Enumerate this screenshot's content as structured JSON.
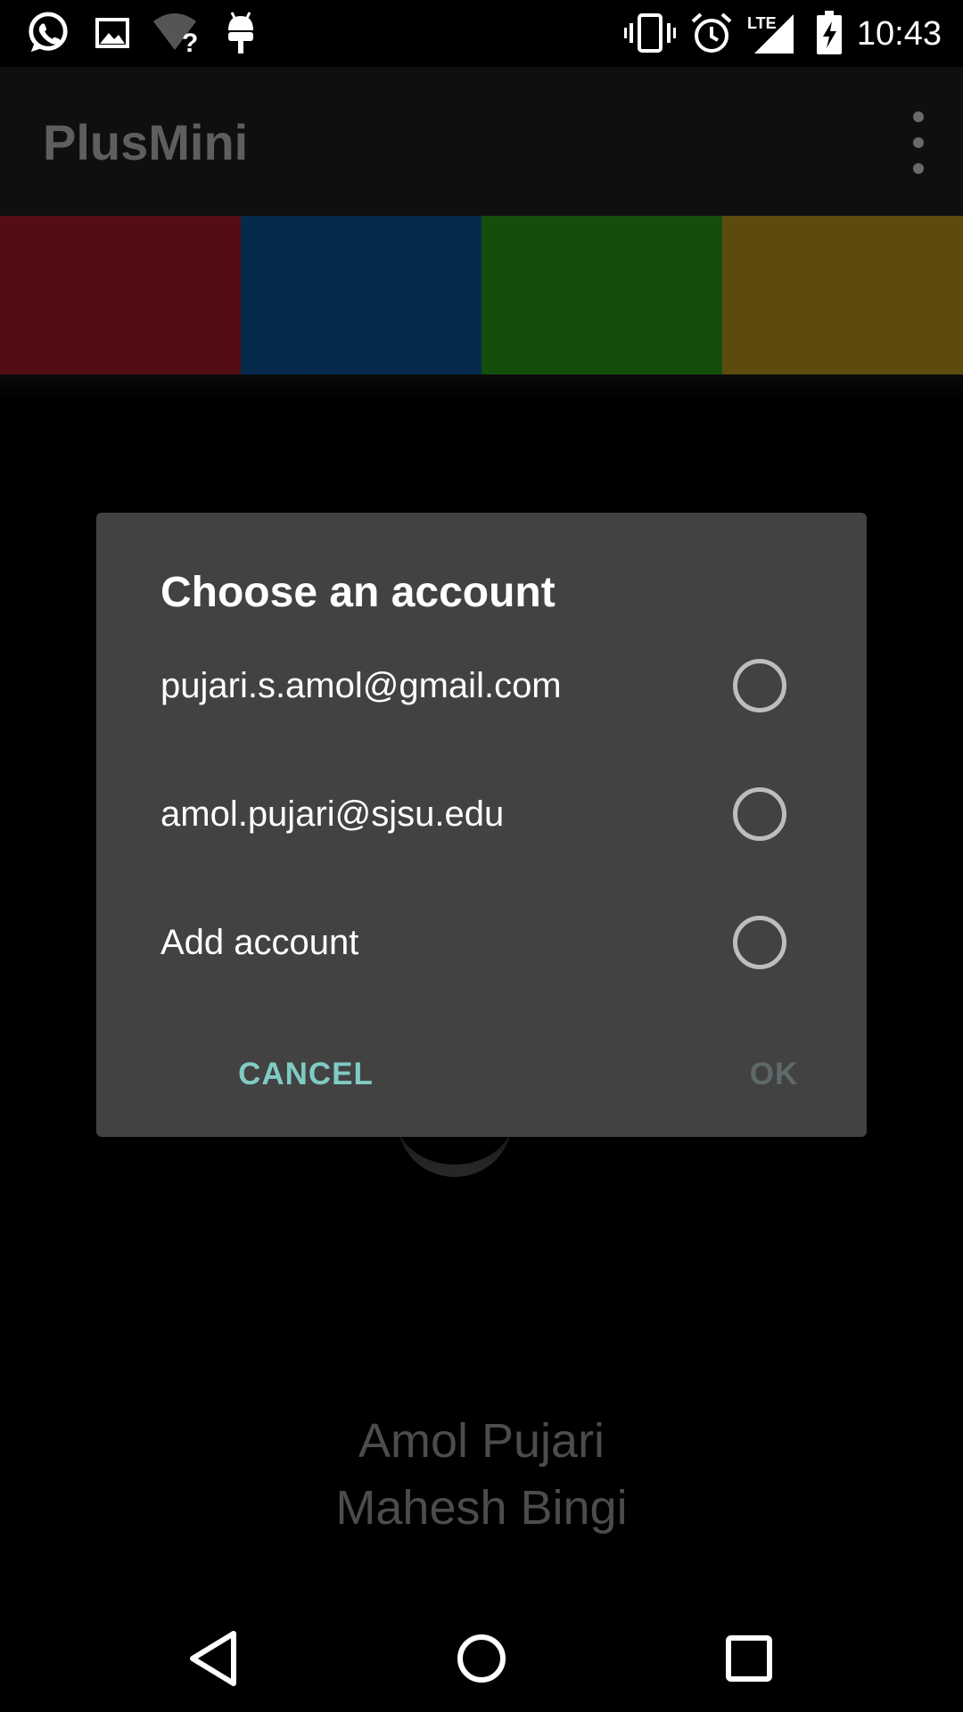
{
  "status_bar": {
    "time": "10:43",
    "left_icons": [
      "whatsapp-icon",
      "image-icon",
      "wifi-unknown-icon",
      "android-icon"
    ],
    "right_icons": [
      "vibrate-icon",
      "alarm-icon",
      "lte-signal-icon",
      "battery-charging-icon"
    ],
    "network_label": "LTE"
  },
  "app_bar": {
    "title": "PlusMini",
    "menu_icon": "overflow-menu-icon"
  },
  "color_tabs": [
    {
      "color": "#540d14"
    },
    {
      "color": "#052a4c"
    },
    {
      "color": "#144d0c"
    },
    {
      "color": "#5c4b0c"
    }
  ],
  "background": {
    "authors": [
      "Amol Pujari",
      "Mahesh Bingi"
    ]
  },
  "dialog": {
    "title": "Choose an account",
    "options": [
      {
        "label": "pujari.s.amol@gmail.com",
        "selected": false
      },
      {
        "label": "amol.pujari@sjsu.edu",
        "selected": false
      },
      {
        "label": "Add account",
        "selected": false
      }
    ],
    "cancel_label": "CANCEL",
    "ok_label": "OK",
    "accent_color": "#80cbc4"
  },
  "nav_bar": {
    "icons": [
      "back-icon",
      "home-icon",
      "recents-icon"
    ]
  }
}
